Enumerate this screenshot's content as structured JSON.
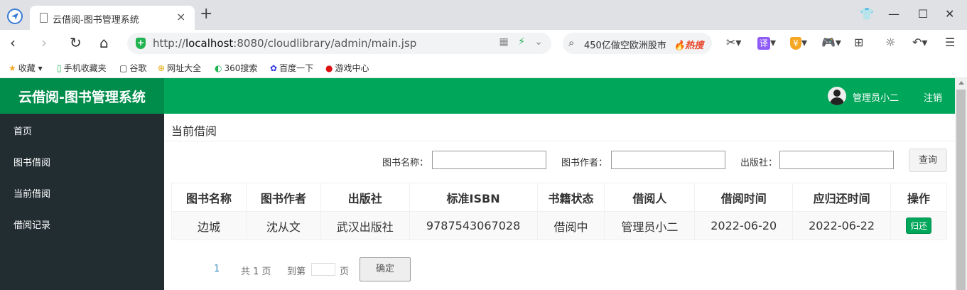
{
  "browser": {
    "tab_title": "云借阅-图书管理系统",
    "url_prefix": "http://",
    "url_host": "localhost",
    "url_rest": ":8080/cloudlibrary/admin/main.jsp",
    "search_text": "450亿做空欧洲股市",
    "search_hot": "🔥热搜",
    "bookmarks": [
      "收藏",
      "手机收藏夹",
      "谷歌",
      "网址大全",
      "360搜索",
      "百度一下",
      "游戏中心"
    ]
  },
  "header": {
    "logo": "云借阅-图书管理系统",
    "username": "管理员小二",
    "logout": "注销"
  },
  "sidebar": {
    "items": [
      "首页",
      "图书借阅",
      "当前借阅",
      "借阅记录"
    ]
  },
  "content": {
    "title": "当前借阅",
    "search": {
      "name_label": "图书名称：",
      "author_label": "图书作者：",
      "press_label": "出版社：",
      "query_button": "查询"
    },
    "table": {
      "headers": [
        "图书名称",
        "图书作者",
        "出版社",
        "标准ISBN",
        "书籍状态",
        "借阅人",
        "借阅时间",
        "应归还时间",
        "操作"
      ],
      "rows": [
        {
          "name": "边城",
          "author": "沈从文",
          "press": "武汉出版社",
          "isbn": "9787543067028",
          "status": "借阅中",
          "borrower": "管理员小二",
          "borrow_time": "2022-06-20",
          "return_time": "2022-06-22",
          "action": "归还"
        }
      ]
    },
    "pagination": {
      "current": "1",
      "total": "共 1 页",
      "goto": "到第",
      "page_unit": "页",
      "confirm": "确定"
    }
  },
  "colors": {
    "header_green": "#00a65a",
    "logo_green": "#008d4c",
    "sidebar_dark": "#222d32"
  }
}
